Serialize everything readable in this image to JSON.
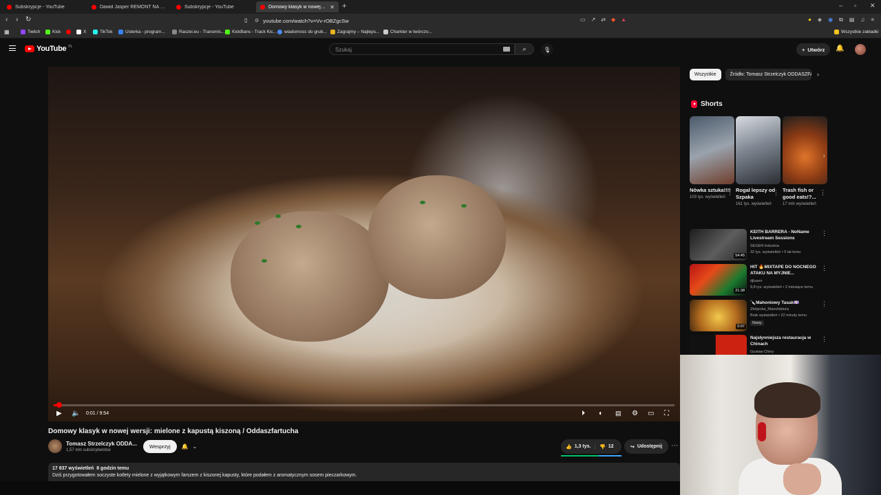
{
  "browser": {
    "tabs": [
      {
        "title": "Subskrypcje - YouTube"
      },
      {
        "title": "Dawid Jasper REMONT NA WARSZAWIE"
      },
      {
        "title": "Subskrypcje - YouTube"
      },
      {
        "title": "Domowy klasyk w nowej wersji: mielone"
      }
    ],
    "url": "youtube.com/watch?v=Vv-rOBZgcSw",
    "bookmarks": [
      {
        "label": "Twitch",
        "color": "#9146ff"
      },
      {
        "label": "Kick",
        "color": "#53fc18"
      },
      {
        "label": "",
        "color": "#ff0000"
      },
      {
        "label": "X",
        "color": "#ffffff"
      },
      {
        "label": "TikTok",
        "color": "#25f4ee"
      },
      {
        "label": "Usterka - program...",
        "color": "#3b82f6"
      },
      {
        "label": "Raszei.eu - Transmis...",
        "color": "#888888"
      },
      {
        "label": "KickBans - Track Kic...",
        "color": "#53fc18"
      },
      {
        "label": "wiadomosc do grub...",
        "color": "#4c8bf5"
      },
      {
        "label": "Zagrajmy – Najleps...",
        "color": "#e6b422"
      },
      {
        "label": "Charkter w twórczo...",
        "color": "#cccccc"
      }
    ],
    "all_bookmarks": "Wszystkie zakładki"
  },
  "header": {
    "logo": "YouTube",
    "country": "PL",
    "search_placeholder": "Szukaj",
    "create_label": "Utwórz"
  },
  "player": {
    "time": "0:01 / 9:54",
    "progress_fraction": 0.002
  },
  "video": {
    "title": "Domowy klasyk w nowej wersji: mielone z kapustą kiszoną / Oddaszfartucha",
    "channel": "Tomasz Strzelczyk ODDA...",
    "subscribers": "1,57 mln subskrybentów",
    "support_label": "Wesprzyj",
    "likes": "1,3 tys.",
    "dislikes": "12",
    "share_label": "Udostępnij",
    "views": "17 837 wyświetleń",
    "age": "8 godzin temu",
    "description": "Dziś przygotowałem soczyste kotlety mielone z wyjątkowym farszem z kiszonej kapusty, które podałem z aromatycznym sosem pieczarkowym."
  },
  "sidebar": {
    "chips": [
      "Wszystkie",
      "Źródło: Tomasz Strzelczyk ODDASZFA"
    ],
    "shorts_title": "Shorts",
    "shorts": [
      {
        "title": "Nówka sztuka!!!!",
        "views": "103 tys. wyświetleń"
      },
      {
        "title": "Rogal lepszy od Szpaka",
        "views": "161 tys. wyświetleń"
      },
      {
        "title": "Trash fish or good eats!?...",
        "views": "17 mln wyświetleń"
      }
    ],
    "recommended": [
      {
        "title": "KEITH BARRERA - NoName Livestream Sessions",
        "channel": "SEGEN Industria",
        "meta": "32 tys. wyświetleń • 5 lat temu",
        "duration": "54:45",
        "badge": ""
      },
      {
        "title": "HIT 🔥MIXTAPE DO NOCNEGO ATAKU NA MYJNIE...",
        "channel": "djlusen",
        "meta": "9,8 tys. wyświetleń • 2 miesiące temu",
        "duration": "21:38",
        "badge": ""
      },
      {
        "title": "🔪Mahoniowy Tasak💷",
        "channel": "Zbójecka_Manufaktura",
        "meta": "Brak wyświetleń • 22 minuty temu",
        "duration": "0:07",
        "badge": "Nowy"
      },
      {
        "title": "Najsłynniejsza restauracja w Chinach",
        "channel": "Gustaw Chiny",
        "meta": "",
        "duration": "",
        "badge": ""
      }
    ]
  },
  "colors": {
    "accent": "#ff0000",
    "bg": "#0f0f0f",
    "chip_bg": "#272727"
  }
}
